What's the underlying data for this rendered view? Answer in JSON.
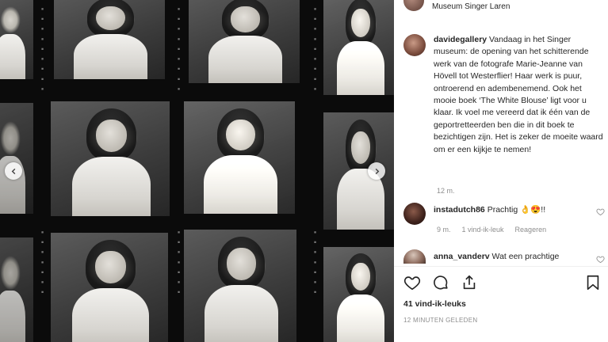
{
  "post": {
    "location": "Museum Singer Laren",
    "caption": {
      "username": "davidegallery",
      "text": "Vandaag in het Singer museum: de opening van het schitterende werk van de fotografe Marie-Jeanne van Hövell tot Westerflier! Haar werk is puur, ontroerend en adembenemend. Ook het mooie boek ‘The White Blouse’ ligt voor u klaar. Ik voel me vereerd dat ik één van de geportretteerden ben die in dit boek te bezichtigen zijn. Het is zeker de moeite waard om er een kijkje te nemen!",
      "age": "12 m."
    },
    "comments": [
      {
        "username": "instadutch86",
        "text": "Prachtig 👌😍!!",
        "age": "9 m.",
        "likes": "1 vind-ik-leuk",
        "reply": "Reageren"
      },
      {
        "username": "anna_vanderv",
        "text": "Wat een prachtige"
      }
    ],
    "likes_label": "41 vind-ik-leuks",
    "timestamp": "12 MINUTEN GELEDEN"
  },
  "icons": {
    "like": "heart-icon",
    "comment": "comment-icon",
    "share": "share-icon",
    "save": "bookmark-icon",
    "prev": "chevron-left-icon",
    "next": "chevron-right-icon"
  },
  "colors": {
    "text": "#262626",
    "muted": "#8e8e8e",
    "divider": "#efefef"
  }
}
